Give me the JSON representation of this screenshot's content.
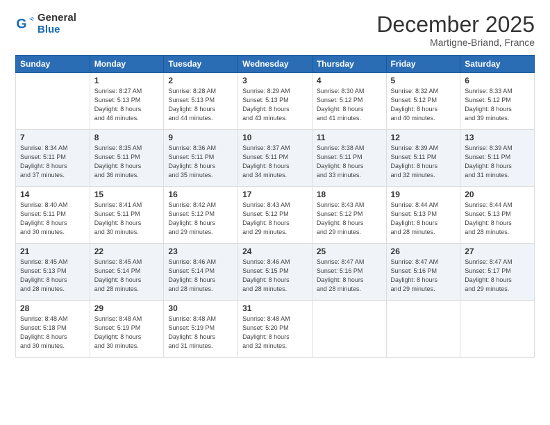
{
  "logo": {
    "general": "General",
    "blue": "Blue"
  },
  "header": {
    "month": "December 2025",
    "location": "Martigne-Briand, France"
  },
  "weekdays": [
    "Sunday",
    "Monday",
    "Tuesday",
    "Wednesday",
    "Thursday",
    "Friday",
    "Saturday"
  ],
  "weeks": [
    [
      {
        "day": "",
        "info": ""
      },
      {
        "day": "1",
        "info": "Sunrise: 8:27 AM\nSunset: 5:13 PM\nDaylight: 8 hours\nand 46 minutes."
      },
      {
        "day": "2",
        "info": "Sunrise: 8:28 AM\nSunset: 5:13 PM\nDaylight: 8 hours\nand 44 minutes."
      },
      {
        "day": "3",
        "info": "Sunrise: 8:29 AM\nSunset: 5:13 PM\nDaylight: 8 hours\nand 43 minutes."
      },
      {
        "day": "4",
        "info": "Sunrise: 8:30 AM\nSunset: 5:12 PM\nDaylight: 8 hours\nand 41 minutes."
      },
      {
        "day": "5",
        "info": "Sunrise: 8:32 AM\nSunset: 5:12 PM\nDaylight: 8 hours\nand 40 minutes."
      },
      {
        "day": "6",
        "info": "Sunrise: 8:33 AM\nSunset: 5:12 PM\nDaylight: 8 hours\nand 39 minutes."
      }
    ],
    [
      {
        "day": "7",
        "info": "Sunrise: 8:34 AM\nSunset: 5:11 PM\nDaylight: 8 hours\nand 37 minutes."
      },
      {
        "day": "8",
        "info": "Sunrise: 8:35 AM\nSunset: 5:11 PM\nDaylight: 8 hours\nand 36 minutes."
      },
      {
        "day": "9",
        "info": "Sunrise: 8:36 AM\nSunset: 5:11 PM\nDaylight: 8 hours\nand 35 minutes."
      },
      {
        "day": "10",
        "info": "Sunrise: 8:37 AM\nSunset: 5:11 PM\nDaylight: 8 hours\nand 34 minutes."
      },
      {
        "day": "11",
        "info": "Sunrise: 8:38 AM\nSunset: 5:11 PM\nDaylight: 8 hours\nand 33 minutes."
      },
      {
        "day": "12",
        "info": "Sunrise: 8:39 AM\nSunset: 5:11 PM\nDaylight: 8 hours\nand 32 minutes."
      },
      {
        "day": "13",
        "info": "Sunrise: 8:39 AM\nSunset: 5:11 PM\nDaylight: 8 hours\nand 31 minutes."
      }
    ],
    [
      {
        "day": "14",
        "info": "Sunrise: 8:40 AM\nSunset: 5:11 PM\nDaylight: 8 hours\nand 30 minutes."
      },
      {
        "day": "15",
        "info": "Sunrise: 8:41 AM\nSunset: 5:11 PM\nDaylight: 8 hours\nand 30 minutes."
      },
      {
        "day": "16",
        "info": "Sunrise: 8:42 AM\nSunset: 5:12 PM\nDaylight: 8 hours\nand 29 minutes."
      },
      {
        "day": "17",
        "info": "Sunrise: 8:43 AM\nSunset: 5:12 PM\nDaylight: 8 hours\nand 29 minutes."
      },
      {
        "day": "18",
        "info": "Sunrise: 8:43 AM\nSunset: 5:12 PM\nDaylight: 8 hours\nand 29 minutes."
      },
      {
        "day": "19",
        "info": "Sunrise: 8:44 AM\nSunset: 5:13 PM\nDaylight: 8 hours\nand 28 minutes."
      },
      {
        "day": "20",
        "info": "Sunrise: 8:44 AM\nSunset: 5:13 PM\nDaylight: 8 hours\nand 28 minutes."
      }
    ],
    [
      {
        "day": "21",
        "info": "Sunrise: 8:45 AM\nSunset: 5:13 PM\nDaylight: 8 hours\nand 28 minutes."
      },
      {
        "day": "22",
        "info": "Sunrise: 8:45 AM\nSunset: 5:14 PM\nDaylight: 8 hours\nand 28 minutes."
      },
      {
        "day": "23",
        "info": "Sunrise: 8:46 AM\nSunset: 5:14 PM\nDaylight: 8 hours\nand 28 minutes."
      },
      {
        "day": "24",
        "info": "Sunrise: 8:46 AM\nSunset: 5:15 PM\nDaylight: 8 hours\nand 28 minutes."
      },
      {
        "day": "25",
        "info": "Sunrise: 8:47 AM\nSunset: 5:16 PM\nDaylight: 8 hours\nand 28 minutes."
      },
      {
        "day": "26",
        "info": "Sunrise: 8:47 AM\nSunset: 5:16 PM\nDaylight: 8 hours\nand 29 minutes."
      },
      {
        "day": "27",
        "info": "Sunrise: 8:47 AM\nSunset: 5:17 PM\nDaylight: 8 hours\nand 29 minutes."
      }
    ],
    [
      {
        "day": "28",
        "info": "Sunrise: 8:48 AM\nSunset: 5:18 PM\nDaylight: 8 hours\nand 30 minutes."
      },
      {
        "day": "29",
        "info": "Sunrise: 8:48 AM\nSunset: 5:19 PM\nDaylight: 8 hours\nand 30 minutes."
      },
      {
        "day": "30",
        "info": "Sunrise: 8:48 AM\nSunset: 5:19 PM\nDaylight: 8 hours\nand 31 minutes."
      },
      {
        "day": "31",
        "info": "Sunrise: 8:48 AM\nSunset: 5:20 PM\nDaylight: 8 hours\nand 32 minutes."
      },
      {
        "day": "",
        "info": ""
      },
      {
        "day": "",
        "info": ""
      },
      {
        "day": "",
        "info": ""
      }
    ]
  ]
}
